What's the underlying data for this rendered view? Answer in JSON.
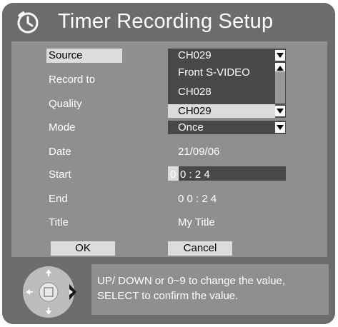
{
  "window": {
    "title": "Timer Recording Setup",
    "title_icon": "timer-icon"
  },
  "fields": [
    {
      "id": "source",
      "label": "Source",
      "value": "CH029"
    },
    {
      "id": "record_to",
      "label": "Record to",
      "value": ""
    },
    {
      "id": "quality",
      "label": "Quality",
      "value": ""
    },
    {
      "id": "mode",
      "label": "Mode",
      "value": "Once"
    },
    {
      "id": "date",
      "label": "Date",
      "value": "21/09/06"
    },
    {
      "id": "start",
      "label": "Start",
      "value_cursor": "0",
      "value_rest": "0 : 2 4"
    },
    {
      "id": "end",
      "label": "End",
      "value": "0 0 : 2 4"
    },
    {
      "id": "title",
      "label": "Title",
      "value": "My Title"
    }
  ],
  "source_dropdown": {
    "options": [
      "Front S-VIDEO",
      "CH028",
      "CH029"
    ],
    "selected": "CH029"
  },
  "buttons": {
    "ok": "OK",
    "cancel": "Cancel"
  },
  "help": {
    "line1": "UP/ DOWN or 0~9 to change the value,",
    "line2": "SELECT to confirm the value."
  },
  "colors": {
    "background": "#6c6c6c",
    "panel": "#8f8f8f",
    "dropdown": "#484848",
    "highlight": "#dcdcdc",
    "text": "#ffffff"
  }
}
